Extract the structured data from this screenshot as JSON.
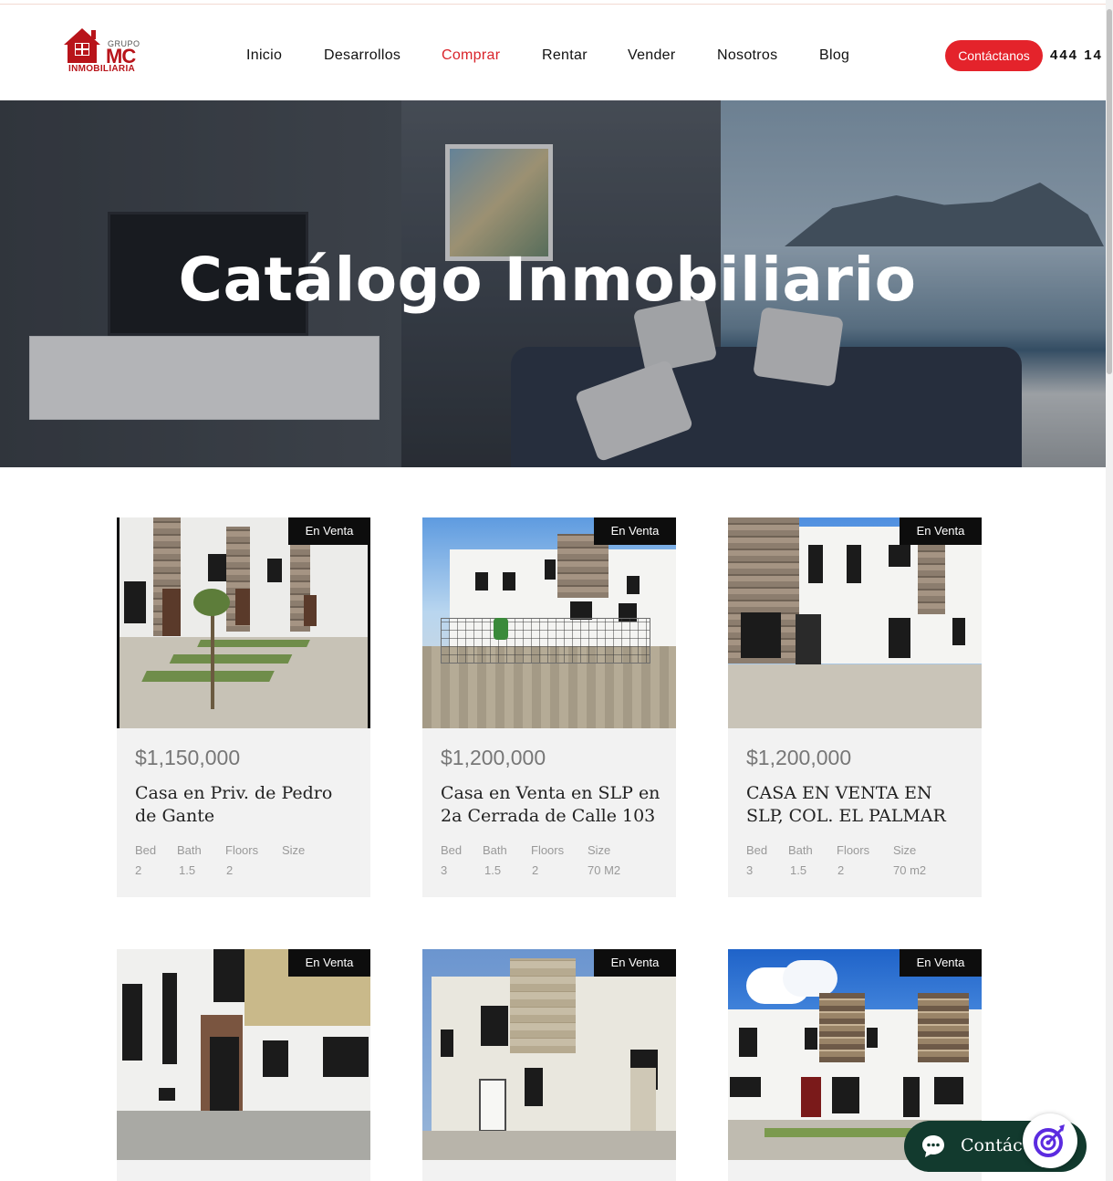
{
  "header": {
    "logo": {
      "top": "GRUPO",
      "main": "MC",
      "bottom": "INMOBILIARIA"
    },
    "nav": [
      {
        "label": "Inicio",
        "active": false
      },
      {
        "label": "Desarrollos",
        "active": false
      },
      {
        "label": "Comprar",
        "active": true
      },
      {
        "label": "Rentar",
        "active": false
      },
      {
        "label": "Vender",
        "active": false
      },
      {
        "label": "Nosotros",
        "active": false
      },
      {
        "label": "Blog",
        "active": false
      }
    ],
    "contact_label": "Contáctanos",
    "phone": "444 14"
  },
  "hero": {
    "title": "Catálogo Inmobiliario"
  },
  "spec_labels": {
    "bed": "Bed",
    "bath": "Bath",
    "floors": "Floors",
    "size": "Size"
  },
  "listings": [
    {
      "status": "En Venta",
      "price": "$1,150,000",
      "title": "Casa en Priv. de Pedro de Gante",
      "bed": "2",
      "bath": "1.5",
      "floors": "2",
      "size": ""
    },
    {
      "status": "En Venta",
      "price": "$1,200,000",
      "title": "Casa en Venta en SLP en 2a Cerrada de Calle 103",
      "bed": "3",
      "bath": "1.5",
      "floors": "2",
      "size": "70 M2"
    },
    {
      "status": "En Venta",
      "price": "$1,200,000",
      "title": "CASA EN VENTA EN SLP, COL. EL PALMAR",
      "bed": "3",
      "bath": "1.5",
      "floors": "2",
      "size": "70 m2"
    },
    {
      "status": "En Venta"
    },
    {
      "status": "En Venta"
    },
    {
      "status": "En Venta"
    }
  ],
  "chat": {
    "label": "Contácta"
  },
  "colors": {
    "accent": "#e4232b",
    "brand": "#b8141a",
    "chat_bg": "#123a2e",
    "card_bg": "#f2f2f2"
  }
}
